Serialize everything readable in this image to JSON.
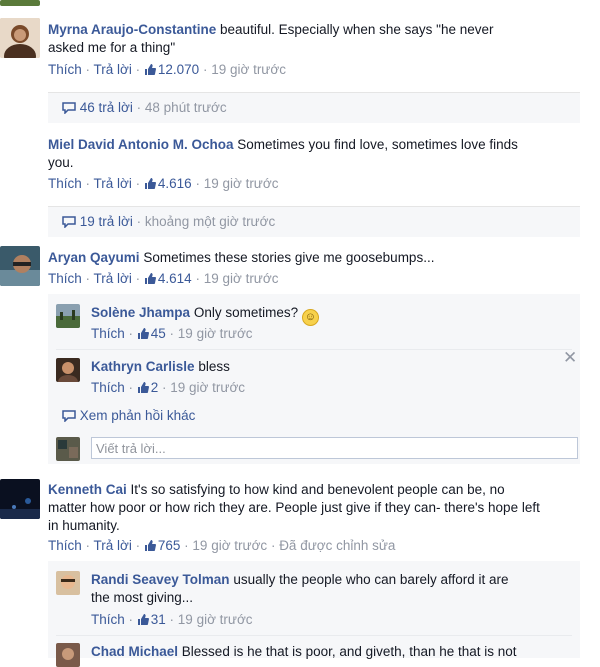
{
  "comments": [
    {
      "author": "Myrna Araujo-Constantine",
      "text_line1": "beautiful. Especially when she says \"he never",
      "text_line2": "asked me for a thing\"",
      "like": "Thích",
      "reply": "Trả lời",
      "likes": "12.070",
      "time": "19 giờ trước",
      "replies_summary": "46 trả lời",
      "replies_time": "48 phút trước"
    },
    {
      "author": "Miel David Antonio M. Ochoa",
      "text_line1": "Sometimes you find love, sometimes love finds",
      "text_line2": "you.",
      "like": "Thích",
      "reply": "Trả lời",
      "likes": "4.616",
      "time": "19 giờ trước",
      "replies_summary": "19 trả lời",
      "replies_time": "khoảng một giờ trước"
    },
    {
      "author": "Aryan Qayumi",
      "text_line1": "Sometimes these stories give me goosebumps...",
      "like": "Thích",
      "reply": "Trả lời",
      "likes": "4.614",
      "time": "19 giờ trước",
      "replies": [
        {
          "author": "Solène Jhampa",
          "text": "Only sometimes?",
          "emoji": "☺",
          "like": "Thích",
          "likes": "45",
          "time": "19 giờ trước"
        },
        {
          "author": "Kathryn Carlisle",
          "text": "bless",
          "like": "Thích",
          "likes": "2",
          "time": "19 giờ trước"
        }
      ],
      "more_replies": "Xem phản hồi khác",
      "reply_placeholder": "Viết trả lời..."
    },
    {
      "author": "Kenneth Cai",
      "text_line1": "It's so satisfying to how kind and benevolent people can be, no",
      "text_line2": "matter how poor or how rich they are. People just give if they can- there's hope left",
      "text_line3": "in humanity.",
      "like": "Thích",
      "reply": "Trả lời",
      "likes": "765",
      "time": "19 giờ trước",
      "edited": "Đã được chỉnh sửa",
      "replies": [
        {
          "author": "Randi Seavey Tolman",
          "text_line1": "usually the people who can barely afford it are",
          "text_line2": "the most giving...",
          "like": "Thích",
          "likes": "31",
          "time": "19 giờ trước"
        },
        {
          "author": "Chad Michael",
          "text_line1": "Blessed is he that is poor, and giveth, than he that is not"
        }
      ]
    }
  ],
  "colors": {
    "link": "#3b5998",
    "meta": "#9197a3",
    "reply_bg": "#f6f7f9"
  }
}
